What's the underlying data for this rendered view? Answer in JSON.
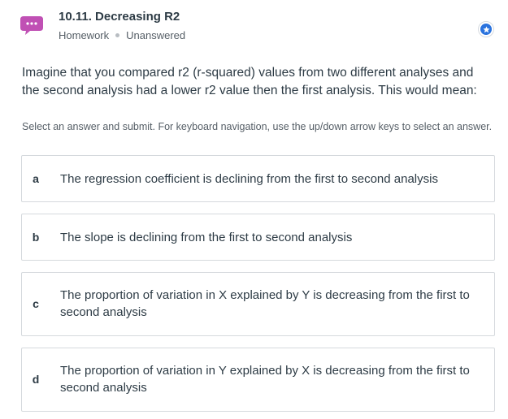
{
  "header": {
    "title": "10.11. Decreasing R2",
    "category": "Homework",
    "status": "Unanswered",
    "chat_icon": "chat-bubble-icon",
    "star_icon": "star-icon",
    "accent_color": "#c050b4",
    "star_color": "#2a73de"
  },
  "question": {
    "text": "Imagine that you compared r2 (r-squared) values from two different analyses and the second analysis had a lower r2 value then the first analysis. This would mean:",
    "instructions": "Select an answer and submit. For keyboard navigation, use the up/down arrow keys to select an answer."
  },
  "choices": [
    {
      "letter": "a",
      "text": "The regression coefficient is declining from the first to second analysis"
    },
    {
      "letter": "b",
      "text": "The slope is declining from the first to second analysis"
    },
    {
      "letter": "c",
      "text": "The proportion of variation in X explained by Y is decreasing from the first to second analysis"
    },
    {
      "letter": "d",
      "text": "The proportion of variation in Y explained by X is decreasing from the first to second analysis"
    }
  ]
}
